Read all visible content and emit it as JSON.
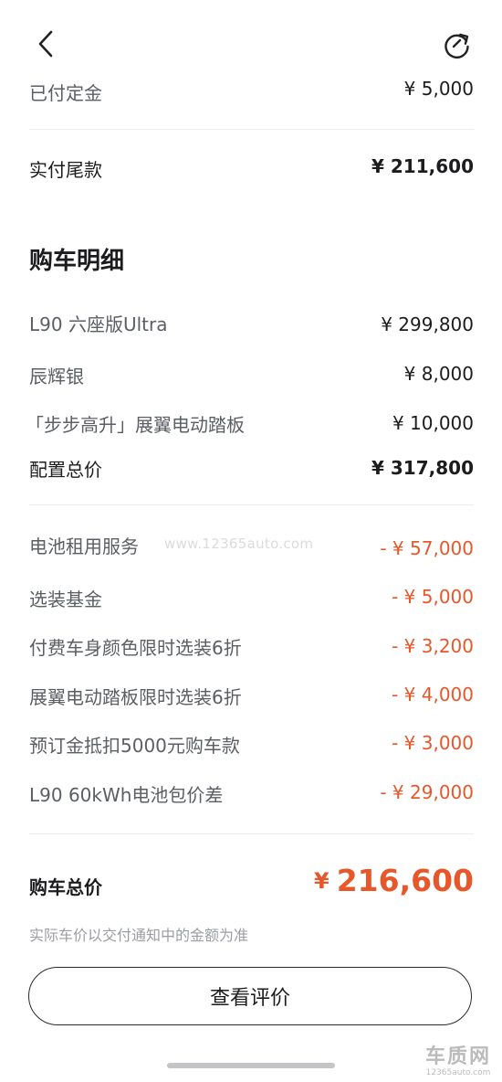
{
  "nav": {
    "back_icon": "chevron-left-icon",
    "refresh_icon": "refresh-icon"
  },
  "summary": {
    "deposit_label": "已付定金",
    "deposit_value": "¥ 5,000",
    "balance_label": "实付尾款",
    "balance_value": "¥ 211,600"
  },
  "details": {
    "title": "购车明细",
    "items": [
      {
        "label": "L90 六座版Ultra",
        "value": "¥ 299,800"
      },
      {
        "label": "辰辉银",
        "value": "¥ 8,000"
      },
      {
        "label": "「步步高升」展翼电动踏板",
        "value": "¥ 10,000"
      }
    ],
    "config_total_label": "配置总价",
    "config_total_value": "¥ 317,800"
  },
  "discounts": [
    {
      "label": "电池租用服务",
      "value": "- ¥ 57,000"
    },
    {
      "label": "选装基金",
      "value": "- ¥ 5,000"
    },
    {
      "label": "付费车身颜色限时选装6折",
      "value": "- ¥ 3,200"
    },
    {
      "label": "展翼电动踏板限时选装6折",
      "value": "- ¥ 4,000"
    },
    {
      "label": "预订金抵扣5000元购车款",
      "value": "- ¥ 3,000"
    },
    {
      "label": "L90 60kWh电池包价差",
      "value": "- ¥ 29,000"
    }
  ],
  "total": {
    "label": "购车总价",
    "currency": "¥",
    "amount": "216,600",
    "note": "实际车价以交付通知中的金额为准"
  },
  "review_button": "查看评价",
  "watermark": "www.12365auto.com",
  "brand": {
    "name": "车质网",
    "url": "12365auto.com"
  },
  "colors": {
    "accent": "#e8572a",
    "text": "#1c1c1e",
    "muted": "#5b5e63"
  }
}
